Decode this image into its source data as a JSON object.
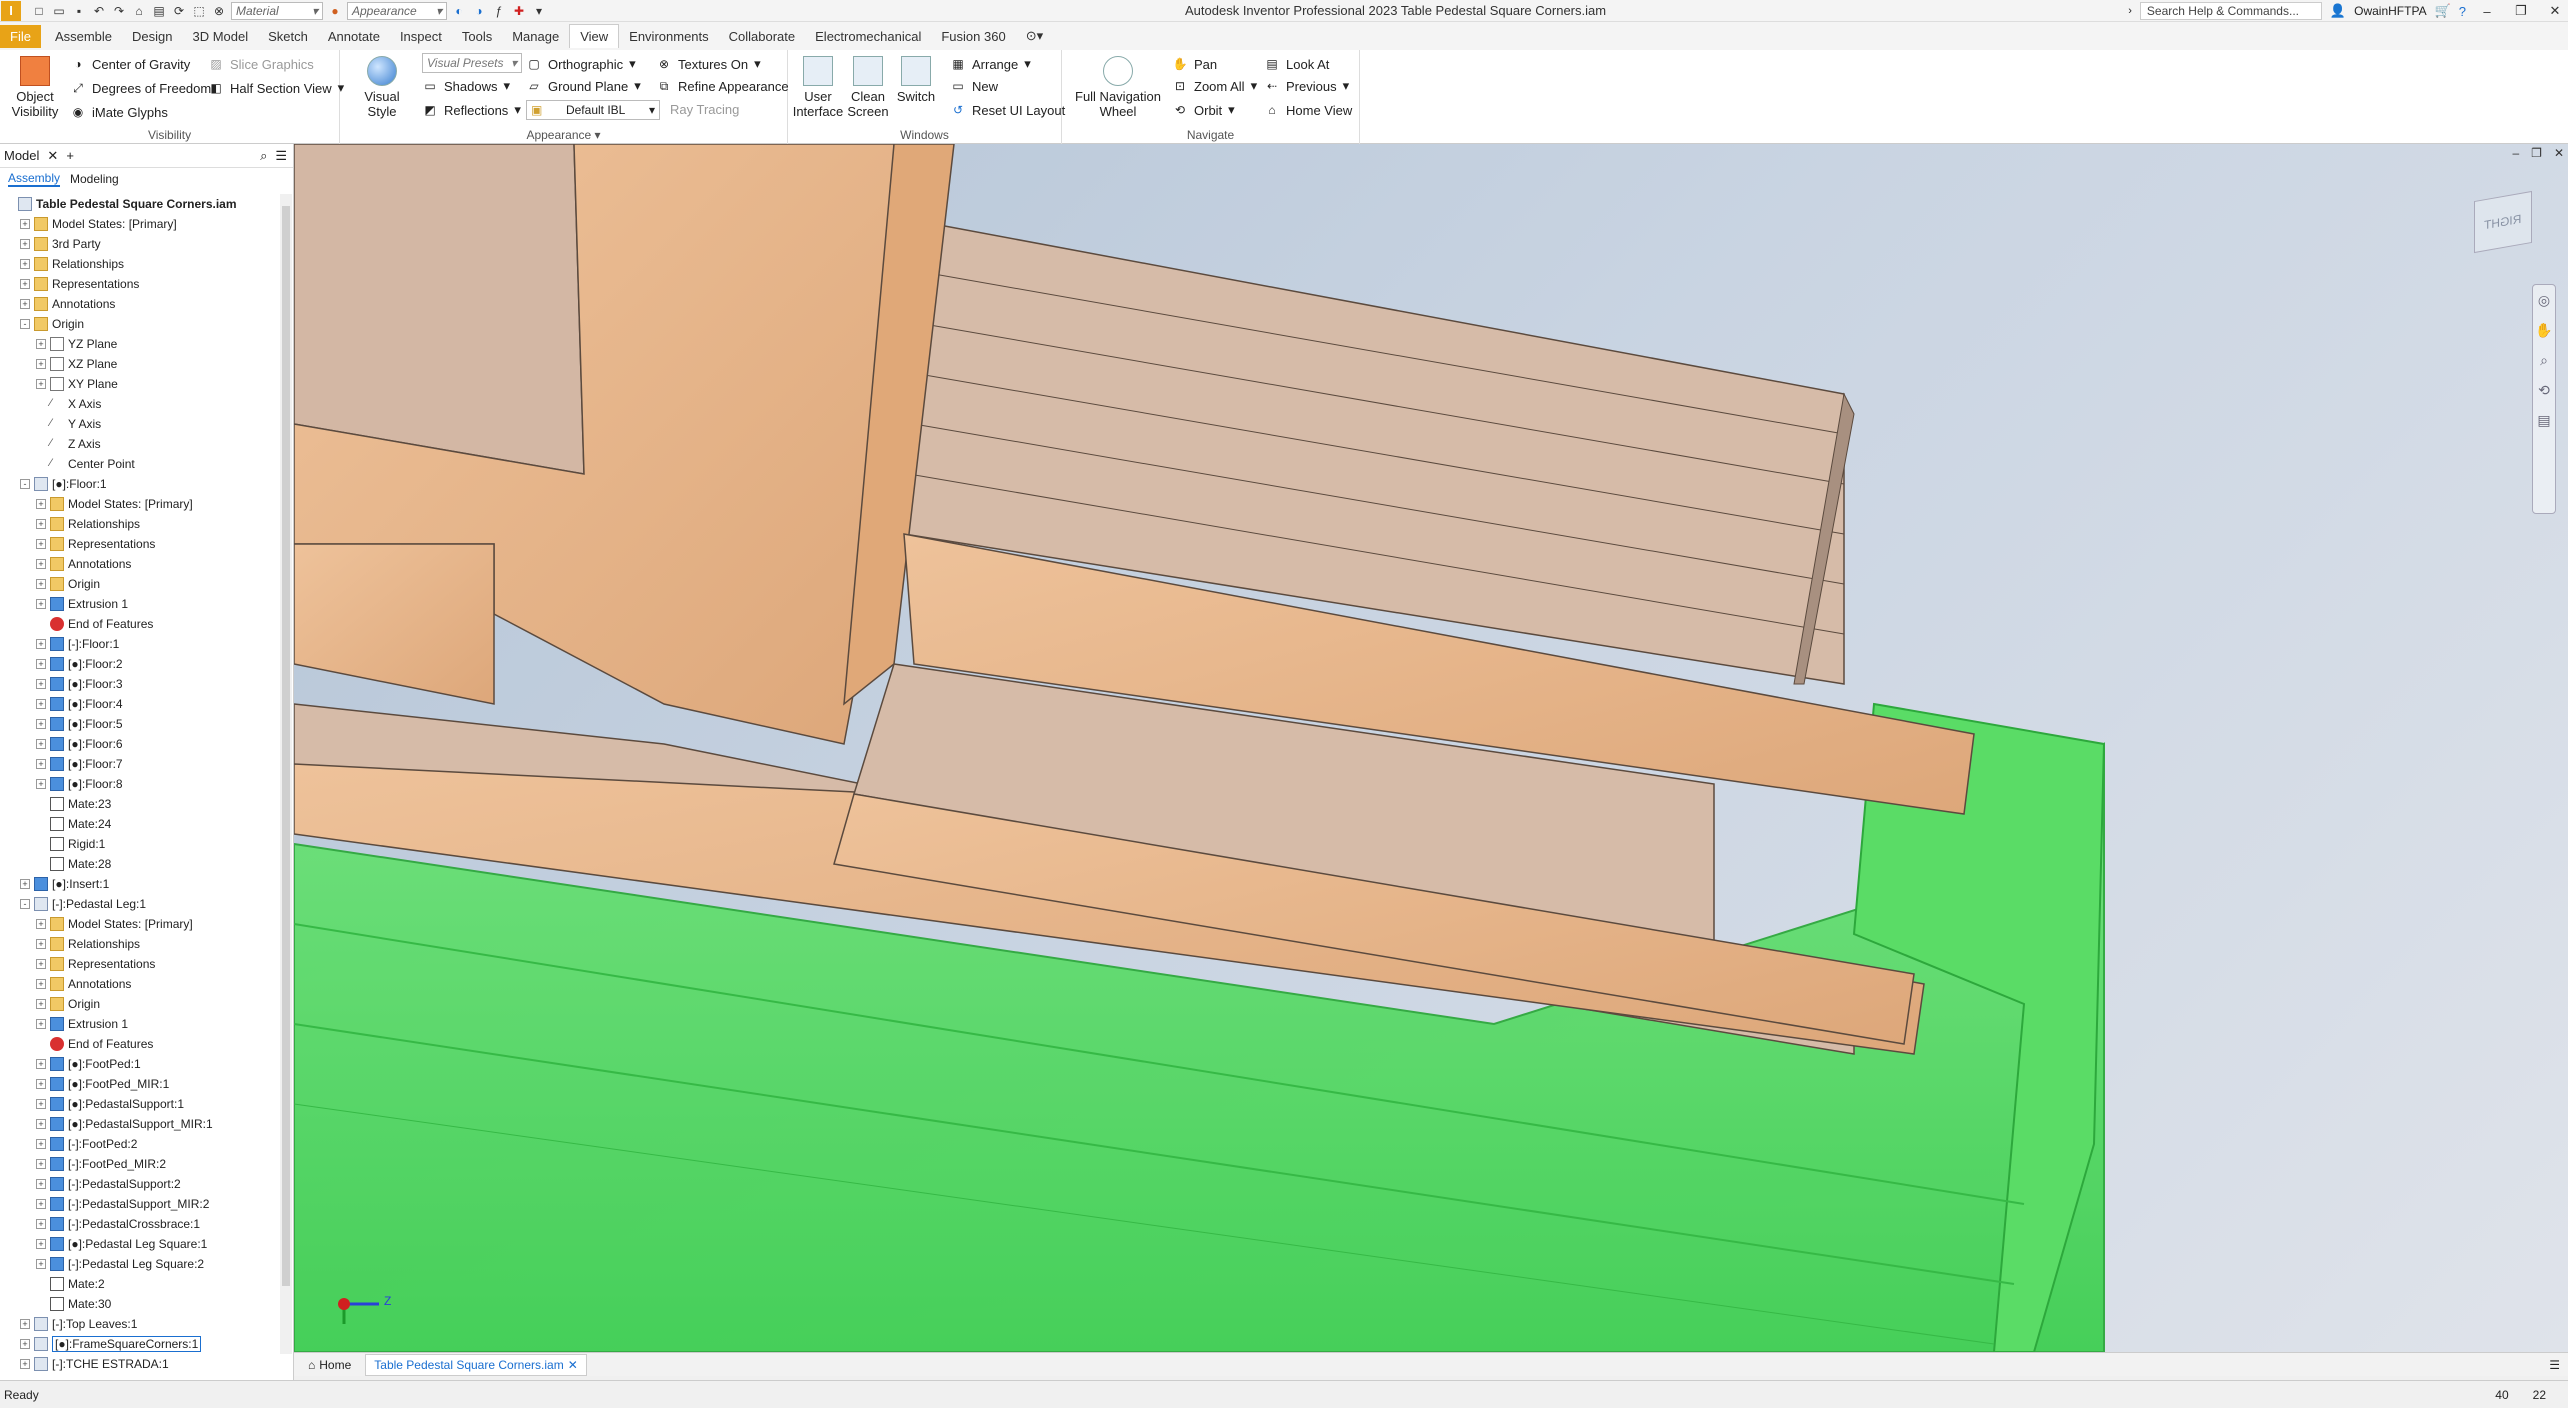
{
  "app": {
    "logo": "I",
    "title": "Autodesk Inventor Professional 2023   Table Pedestal Square Corners.iam"
  },
  "qat": {
    "material": "Material",
    "appearance": "Appearance"
  },
  "search": {
    "placeholder": "Search Help & Commands..."
  },
  "user": {
    "name": "OwainHFTPA"
  },
  "tabs": [
    "File",
    "Assemble",
    "Design",
    "3D Model",
    "Sketch",
    "Annotate",
    "Inspect",
    "Tools",
    "Manage",
    "View",
    "Environments",
    "Collaborate",
    "Electromechanical",
    "Fusion 360"
  ],
  "active_tab": "View",
  "ribbon": {
    "visibility": {
      "title": "Visibility",
      "object_visibility": "Object Visibility",
      "center_of_gravity": "Center of Gravity",
      "degrees_of_freedom": "Degrees of Freedom",
      "imate_glyphs": "iMate Glyphs",
      "slice_graphics": "Slice Graphics",
      "half_section_view": "Half Section View"
    },
    "appearance": {
      "title": "Appearance",
      "visual_style": "Visual Style",
      "visual_presets": "Visual Presets",
      "shadows": "Shadows",
      "reflections": "Reflections",
      "orthographic": "Orthographic",
      "ground_plane": "Ground Plane",
      "default_ibl": "Default IBL",
      "textures_on": "Textures On",
      "refine_appearance": "Refine Appearance",
      "ray_tracing": "Ray Tracing"
    },
    "windows": {
      "title": "Windows",
      "user_interface": "User Interface",
      "clean_screen": "Clean Screen",
      "switch": "Switch",
      "arrange": "Arrange",
      "new": "New",
      "reset_ui_layout": "Reset UI Layout"
    },
    "navigate": {
      "title": "Navigate",
      "full_navigation_wheel": "Full Navigation Wheel",
      "pan": "Pan",
      "zoom_all": "Zoom All",
      "orbit": "Orbit",
      "look_at": "Look At",
      "previous": "Previous",
      "home_view": "Home View"
    }
  },
  "browser": {
    "tab_label": "Model",
    "subtabs": [
      "Assembly",
      "Modeling"
    ],
    "tree": [
      {
        "label": "Table Pedestal Square Corners.iam",
        "indent": 0,
        "icon": "asm",
        "bold": true
      },
      {
        "label": "Model States: [Primary]",
        "indent": 1,
        "icon": "folder",
        "expand": "+"
      },
      {
        "label": "3rd Party",
        "indent": 1,
        "icon": "folder",
        "expand": "+"
      },
      {
        "label": "Relationships",
        "indent": 1,
        "icon": "folder",
        "expand": "+"
      },
      {
        "label": "Representations",
        "indent": 1,
        "icon": "folder",
        "expand": "+"
      },
      {
        "label": "Annotations",
        "indent": 1,
        "icon": "folder",
        "expand": "+"
      },
      {
        "label": "Origin",
        "indent": 1,
        "icon": "folder",
        "expand": "-"
      },
      {
        "label": "YZ Plane",
        "indent": 2,
        "icon": "plane",
        "expand": "+"
      },
      {
        "label": "XZ Plane",
        "indent": 2,
        "icon": "plane",
        "expand": "+"
      },
      {
        "label": "XY Plane",
        "indent": 2,
        "icon": "plane",
        "expand": "+"
      },
      {
        "label": "X Axis",
        "indent": 2,
        "icon": "ax"
      },
      {
        "label": "Y Axis",
        "indent": 2,
        "icon": "ax"
      },
      {
        "label": "Z Axis",
        "indent": 2,
        "icon": "ax"
      },
      {
        "label": "Center Point",
        "indent": 2,
        "icon": "ax"
      },
      {
        "label": "[●]:Floor:1",
        "indent": 1,
        "icon": "asm",
        "expand": "-"
      },
      {
        "label": "Model States: [Primary]",
        "indent": 2,
        "icon": "folder",
        "expand": "+"
      },
      {
        "label": "Relationships",
        "indent": 2,
        "icon": "folder",
        "expand": "+"
      },
      {
        "label": "Representations",
        "indent": 2,
        "icon": "folder",
        "expand": "+"
      },
      {
        "label": "Annotations",
        "indent": 2,
        "icon": "folder",
        "expand": "+"
      },
      {
        "label": "Origin",
        "indent": 2,
        "icon": "folder",
        "expand": "+"
      },
      {
        "label": "Extrusion 1",
        "indent": 2,
        "icon": "part",
        "expand": "+"
      },
      {
        "label": "End of Features",
        "indent": 2,
        "icon": "err"
      },
      {
        "label": "[-]:Floor:1",
        "indent": 2,
        "icon": "part",
        "expand": "+"
      },
      {
        "label": "[●]:Floor:2",
        "indent": 2,
        "icon": "part",
        "expand": "+"
      },
      {
        "label": "[●]:Floor:3",
        "indent": 2,
        "icon": "part",
        "expand": "+"
      },
      {
        "label": "[●]:Floor:4",
        "indent": 2,
        "icon": "part",
        "expand": "+"
      },
      {
        "label": "[●]:Floor:5",
        "indent": 2,
        "icon": "part",
        "expand": "+"
      },
      {
        "label": "[●]:Floor:6",
        "indent": 2,
        "icon": "part",
        "expand": "+"
      },
      {
        "label": "[●]:Floor:7",
        "indent": 2,
        "icon": "part",
        "expand": "+"
      },
      {
        "label": "[●]:Floor:8",
        "indent": 2,
        "icon": "part",
        "expand": "+"
      },
      {
        "label": "Mate:23",
        "indent": 2,
        "icon": "mate"
      },
      {
        "label": "Mate:24",
        "indent": 2,
        "icon": "mate"
      },
      {
        "label": "Rigid:1",
        "indent": 2,
        "icon": "mate"
      },
      {
        "label": "Mate:28",
        "indent": 2,
        "icon": "mate"
      },
      {
        "label": "[●]:Insert:1",
        "indent": 1,
        "icon": "part",
        "expand": "+"
      },
      {
        "label": "[-]:Pedastal Leg:1",
        "indent": 1,
        "icon": "asm",
        "expand": "-"
      },
      {
        "label": "Model States: [Primary]",
        "indent": 2,
        "icon": "folder",
        "expand": "+"
      },
      {
        "label": "Relationships",
        "indent": 2,
        "icon": "folder",
        "expand": "+"
      },
      {
        "label": "Representations",
        "indent": 2,
        "icon": "folder",
        "expand": "+"
      },
      {
        "label": "Annotations",
        "indent": 2,
        "icon": "folder",
        "expand": "+"
      },
      {
        "label": "Origin",
        "indent": 2,
        "icon": "folder",
        "expand": "+"
      },
      {
        "label": "Extrusion 1",
        "indent": 2,
        "icon": "part",
        "expand": "+"
      },
      {
        "label": "End of Features",
        "indent": 2,
        "icon": "err"
      },
      {
        "label": "[●]:FootPed:1",
        "indent": 2,
        "icon": "part",
        "expand": "+"
      },
      {
        "label": "[●]:FootPed_MIR:1",
        "indent": 2,
        "icon": "part",
        "expand": "+"
      },
      {
        "label": "[●]:PedastalSupport:1",
        "indent": 2,
        "icon": "part",
        "expand": "+"
      },
      {
        "label": "[●]:PedastalSupport_MIR:1",
        "indent": 2,
        "icon": "part",
        "expand": "+"
      },
      {
        "label": "[-]:FootPed:2",
        "indent": 2,
        "icon": "part",
        "expand": "+"
      },
      {
        "label": "[-]:FootPed_MIR:2",
        "indent": 2,
        "icon": "part",
        "expand": "+"
      },
      {
        "label": "[-]:PedastalSupport:2",
        "indent": 2,
        "icon": "part",
        "expand": "+"
      },
      {
        "label": "[-]:PedastalSupport_MIR:2",
        "indent": 2,
        "icon": "part",
        "expand": "+"
      },
      {
        "label": "[-]:PedastalCrossbrace:1",
        "indent": 2,
        "icon": "part",
        "expand": "+"
      },
      {
        "label": "[●]:Pedastal Leg Square:1",
        "indent": 2,
        "icon": "part",
        "expand": "+"
      },
      {
        "label": "[-]:Pedastal Leg Square:2",
        "indent": 2,
        "icon": "part",
        "expand": "+"
      },
      {
        "label": "Mate:2",
        "indent": 2,
        "icon": "mate"
      },
      {
        "label": "Mate:30",
        "indent": 2,
        "icon": "mate"
      },
      {
        "label": "[-]:Top Leaves:1",
        "indent": 1,
        "icon": "asm",
        "expand": "+"
      },
      {
        "label": "[●]:FrameSquareCorners:1",
        "indent": 1,
        "icon": "asm",
        "expand": "+",
        "selected": true
      },
      {
        "label": "[-]:TCHE ESTRADA:1",
        "indent": 1,
        "icon": "asm",
        "expand": "+"
      }
    ]
  },
  "viewport": {
    "viewcube_label": "RIGHT",
    "triad_z": "Z"
  },
  "doc_tabs": {
    "home": "Home",
    "active": "Table Pedestal Square Corners.iam"
  },
  "status": {
    "text": "Ready",
    "num1": "40",
    "num2": "22"
  },
  "colors": {
    "accent": "#e8a317",
    "selection_green": "#4ddc5c",
    "wood": "#e8b98b"
  }
}
